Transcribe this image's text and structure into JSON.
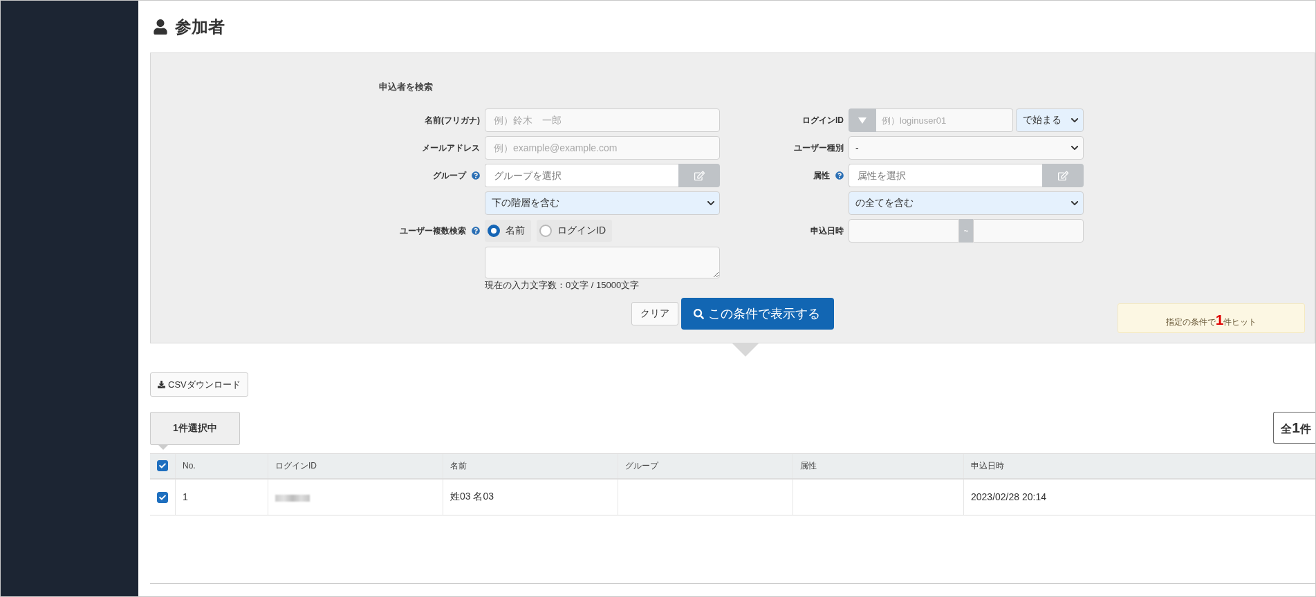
{
  "page": {
    "title": "参加者"
  },
  "search": {
    "heading": "申込者を検索",
    "name_field": {
      "label": "名前(フリガナ)",
      "placeholder": "例）鈴木　一郎"
    },
    "email_field": {
      "label": "メールアドレス",
      "placeholder": "例）example@example.com"
    },
    "group_field": {
      "label": "グループ",
      "placeholder": "グループを選択",
      "scope": "下の階層を含む"
    },
    "multi_search": {
      "label": "ユーザー複数検索",
      "options": [
        {
          "label": "名前",
          "selected": true
        },
        {
          "label": "ログインID",
          "selected": false
        }
      ],
      "counter": "現在の入力文字数：0文字 / 15000文字"
    },
    "login_id_field": {
      "label": "ログインID",
      "placeholder": "例）loginuser01",
      "match": "で始まる"
    },
    "user_type_field": {
      "label": "ユーザー種別",
      "value": "-"
    },
    "attribute_field": {
      "label": "属性",
      "placeholder": "属性を選択",
      "scope": "の全てを含む"
    },
    "date_field": {
      "label": "申込日時",
      "separator": "~"
    },
    "clear_button": "クリア",
    "submit_button": "この条件で表示する",
    "hit_message": "指定の条件で**1**件ヒット"
  },
  "csv_button": "CSVダウンロード",
  "selected_badge": "1件選択中",
  "total": "全**1**件",
  "table": {
    "select_all_checked": true,
    "columns": [
      "No.",
      "ログインID",
      "名前",
      "グループ",
      "属性",
      "申込日時"
    ],
    "rows": [
      {
        "checked": true,
        "cells": [
          {
            "kind": "text",
            "text": "1"
          },
          {
            "kind": "redacted"
          },
          {
            "kind": "text",
            "text": "姓03 名03"
          },
          {
            "kind": "empty"
          },
          {
            "kind": "empty"
          },
          {
            "kind": "text",
            "text": "2023/02/28 20:14"
          }
        ]
      }
    ]
  }
}
